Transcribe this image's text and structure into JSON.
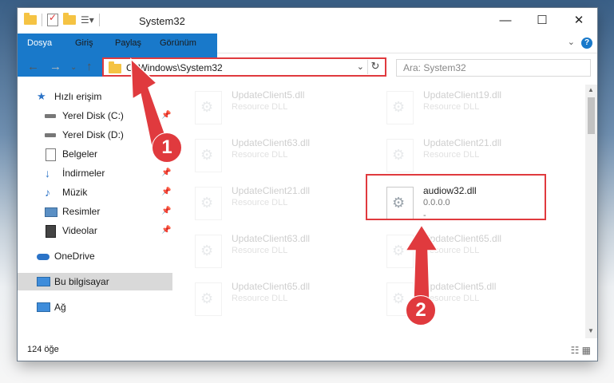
{
  "window": {
    "title": "System32"
  },
  "ribbon": {
    "tabs": [
      "Dosya",
      "Giriş",
      "Paylaş",
      "Görünüm"
    ],
    "help": "?"
  },
  "address": {
    "path": "C:\\Windows\\System32"
  },
  "search": {
    "placeholder": "Ara: System32"
  },
  "sidebar": {
    "items": [
      {
        "label": "Hızlı erişim",
        "icon": "star-icon",
        "pinned": false
      },
      {
        "label": "Yerel Disk (C:)",
        "icon": "drive-icon",
        "pinned": true
      },
      {
        "label": "Yerel Disk (D:)",
        "icon": "drive-icon",
        "pinned": false
      },
      {
        "label": "Belgeler",
        "icon": "documents-icon",
        "pinned": false
      },
      {
        "label": "İndirmeler",
        "icon": "download-icon",
        "pinned": true
      },
      {
        "label": "Müzik",
        "icon": "music-icon",
        "pinned": true
      },
      {
        "label": "Resimler",
        "icon": "pictures-icon",
        "pinned": true
      },
      {
        "label": "Videolar",
        "icon": "videos-icon",
        "pinned": true
      },
      {
        "label": "OneDrive",
        "icon": "cloud-icon",
        "pinned": false
      },
      {
        "label": "Bu bilgisayar",
        "icon": "computer-icon",
        "pinned": false,
        "selected": true
      },
      {
        "label": "Ağ",
        "icon": "network-icon",
        "pinned": false
      }
    ]
  },
  "files": [
    {
      "name": "UpdateClient5.dll",
      "type": "Resource DLL"
    },
    {
      "name": "UpdateClient19.dll",
      "type": "Resource DLL"
    },
    {
      "name": "UpdateClient63.dll",
      "type": "Resource DLL"
    },
    {
      "name": "UpdateClient21.dll",
      "type": "Resource DLL"
    },
    {
      "name": "UpdateClient21.dll",
      "type": "Resource DLL"
    },
    {
      "name": "audiow32.dll",
      "type": "0.0.0.0",
      "extra": "-"
    },
    {
      "name": "UpdateClient63.dll",
      "type": "Resource DLL"
    },
    {
      "name": "UpdateClient65.dll",
      "type": "Resource DLL"
    },
    {
      "name": "UpdateClient65.dll",
      "type": "Resource DLL"
    },
    {
      "name": "UpdateClient5.dll",
      "type": "Resource DLL"
    }
  ],
  "status": {
    "count": "124 öğe"
  },
  "annotations": {
    "step1": "1",
    "step2": "2",
    "color": "#e03a3e"
  }
}
